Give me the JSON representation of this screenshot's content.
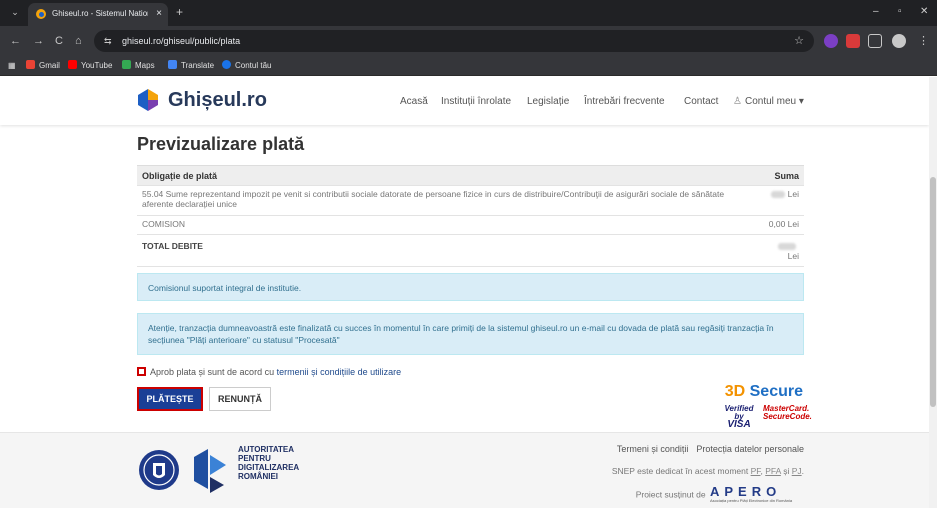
{
  "browser": {
    "tab_title": "Ghiseul.ro - Sistemul National El",
    "tab_close": "×",
    "new_tab": "+",
    "url": "ghiseul.ro/ghiseul/public/plata",
    "window_controls": {
      "minimize": "–",
      "maximize": "▫",
      "close": "✕"
    },
    "nav_icons": {
      "back": "←",
      "forward": "→",
      "reload": "C",
      "home": "⌂",
      "site_info": "⇆",
      "star": "☆",
      "menu": "⋮",
      "tab_list": "⌄"
    },
    "bookmarks": [
      {
        "label": "Gmail",
        "icon": "gmail-icon",
        "color": "#ea4335"
      },
      {
        "label": "YouTube",
        "icon": "youtube-icon",
        "color": "#ff0000"
      },
      {
        "label": "Maps",
        "icon": "maps-icon",
        "color": "#34a853"
      },
      {
        "label": "Translate",
        "icon": "translate-icon",
        "color": "#4285f4"
      },
      {
        "label": "Contul tău",
        "icon": "account-icon",
        "color": "#1a73e8"
      }
    ]
  },
  "site": {
    "logo_text": "Ghișeul.ro",
    "nav": [
      {
        "label": "Acasă"
      },
      {
        "label": "Instituții înrolate"
      },
      {
        "label": "Legislație"
      },
      {
        "label": "Întrebări frecvente"
      },
      {
        "label": "Contact"
      },
      {
        "label": "Contul meu ▾",
        "icon": "user-icon"
      }
    ]
  },
  "main": {
    "title": "Previzualizare plată",
    "table": {
      "headers": [
        "Obligație de plată",
        "Suma"
      ],
      "rows": [
        {
          "description": "55.04 Sume reprezentand impozit pe venit si contributii sociale datorate de persoane fizice in curs de distribuire/Contribuţii de asigurări sociale de sănătate aferente declarației unice",
          "amount": "Lei",
          "amount_redacted": true
        },
        {
          "description": "COMISION",
          "amount": "0,00 Lei",
          "amount_redacted": false
        },
        {
          "description": "TOTAL DEBITE",
          "amount": "Lei",
          "amount_redacted": true
        }
      ]
    },
    "alerts": [
      "Comisionul suportat integral de institutie.",
      "Atenție, tranzacția dumneavoastră este finalizată cu succes în momentul în care primiți de la sistemul ghiseul.ro un e-mail cu dovada de plată sau regăsiți tranzacția în secțiunea \"Plăți anterioare\" cu statusul \"Procesată\""
    ],
    "agree_text": "Aprob plata și sunt de acord cu ",
    "agree_link": "termenii și condițiile de utilizare",
    "agree_checked": false,
    "pay_button": "PLĂTEȘTE",
    "cancel_button": "RENUNȚĂ",
    "secure3d": {
      "title_prefix": "3D",
      "title_suffix": " Secure",
      "visa_line1": "Verified by",
      "visa_line2": "VISA",
      "mc_line1": "MasterCard.",
      "mc_line2": "SecureCode."
    }
  },
  "footer": {
    "authority": [
      "AUTORITATEA",
      "PENTRU",
      "DIGITALIZAREA",
      "ROMÂNIEI"
    ],
    "links": [
      "Termeni și condiții",
      "Protecția datelor personale"
    ],
    "snep_text": "SNEP este dedicat în acest moment ",
    "snep_pf": "PF",
    "snep_pfa": "PFA",
    "snep_si": " și ",
    "snep_pj": "PJ",
    "snep_sep": ", ",
    "snep_end": ".",
    "apero_text": "Proiect susținut de",
    "apero_letters": "APERO",
    "apero_sub": "Asociația pentru Plăți Electronice din România"
  },
  "colors": {
    "brand_blue": "#1a3f96",
    "highlight_red": "#cc0000",
    "alert_bg": "#d9edf7",
    "alert_text": "#31708f",
    "chrome_dark": "#202124"
  }
}
